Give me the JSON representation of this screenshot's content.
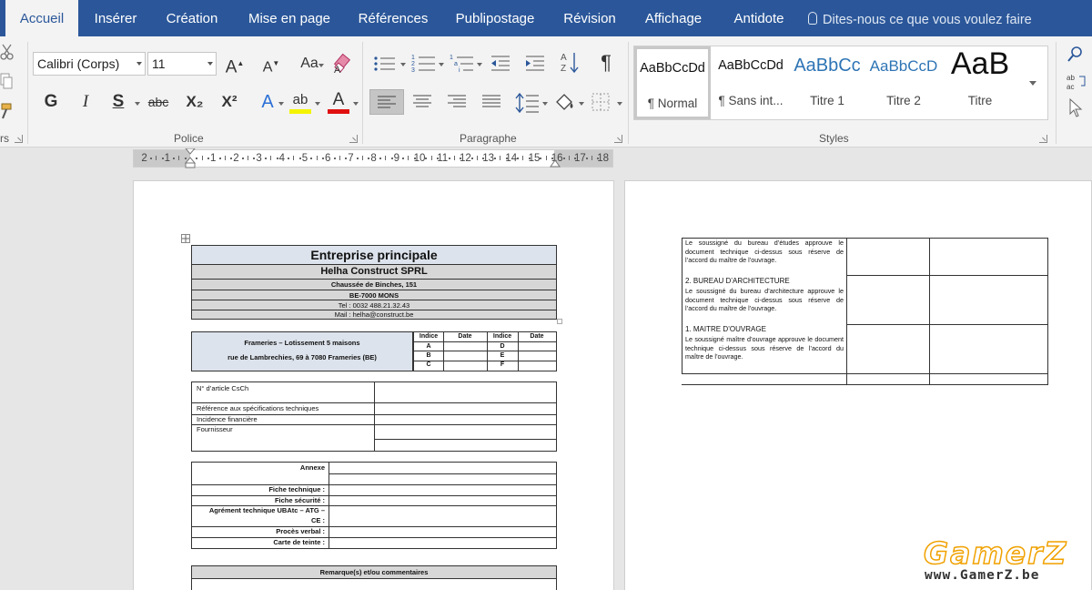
{
  "tabs": [
    "Accueil",
    "Insérer",
    "Création",
    "Mise en page",
    "Références",
    "Publipostage",
    "Révision",
    "Affichage",
    "Antidote"
  ],
  "tell_me": "Dites-nous ce que vous voulez faire",
  "ribbon": {
    "clipboard_label": "rs",
    "font_name": "Calibri (Corps)",
    "font_size": "11",
    "police_label": "Police",
    "paragraph_label": "Paragraphe",
    "styles_label": "Styles",
    "buttons": {
      "bold": "G",
      "italic": "I",
      "underline": "S",
      "strike": "abc",
      "subscript": "X₂",
      "superscript": "X²",
      "case": "Aa",
      "grow_font": "A",
      "shrink_font": "A",
      "text_effect": "A",
      "highlight": "ab",
      "font_color": "A",
      "pilcrow": "¶",
      "sort": "A↓Z"
    },
    "styles": [
      {
        "sample": "AaBbCcDd",
        "name": "¶ Normal"
      },
      {
        "sample": "AaBbCcDd",
        "name": "¶ Sans int..."
      },
      {
        "sample": "AaBbCc",
        "name": "Titre 1"
      },
      {
        "sample": "AaBbCcD",
        "name": "Titre 2"
      },
      {
        "sample": "AaB",
        "name": "Titre"
      }
    ],
    "colors": {
      "highlight": "#f4f400",
      "font_color": "#e01010",
      "accent": "#2b579a"
    }
  },
  "ruler_numbers": [
    "2",
    "1",
    "1",
    "2",
    "3",
    "4",
    "5",
    "6",
    "7",
    "8",
    "9",
    "10",
    "11",
    "12",
    "13",
    "14",
    "15",
    "16",
    "17",
    "18"
  ],
  "doc": {
    "header_title": "Entreprise principale",
    "company": "Helha Construct SPRL",
    "address1": "Chaussée de Binches, 151",
    "address2": "BE-7000 MONS",
    "tel": "Tel : 0032 488.21.32.43",
    "mail": "Mail : helha@construct.be",
    "project_line1": "Frameries – Lotissement 5 maisons",
    "project_line2": "rue de Lambrechies, 69 à 7080 Frameries (BE)",
    "index_headers": [
      "Indice",
      "Date",
      "Indice",
      "Date"
    ],
    "index_left": [
      "A",
      "B",
      "C"
    ],
    "index_right": [
      "D",
      "E",
      "F"
    ],
    "article_rows": [
      "N° d’article CsCh",
      "Référence aux spécifications techniques",
      "Incidence financière",
      "Fournisseur"
    ],
    "annexe_label": "Annexe",
    "annex_rows": [
      "Fiche technique :",
      "Fiche sécurité :",
      "Agrément technique UBAtc – ATG –",
      "CE :",
      "Procès verbal :",
      "Carte de teinte :"
    ],
    "remarks_header": "Remarque(s) et/ou commentaires",
    "approvals": {
      "p1": "Le soussigné du bureau d’études approuve le document technique ci-dessus sous réserve de l’accord du maître de l’ouvrage.",
      "h2": "2. BUREAU D’ARCHITECTURE",
      "p2": "Le soussigné du bureau d’architecture approuve le document technique ci-dessus sous réserve de l’accord du maître de l’ouvrage.",
      "h3": "1. MAITRE D’OUVRAGE",
      "p3": "Le soussigné maître d’ouvrage approuve le document technique ci-dessus sous réserve de l’accord du maître de l’ouvrage."
    }
  },
  "watermark": {
    "line1": "GamerZ",
    "line2": "www.GamerZ.be"
  }
}
